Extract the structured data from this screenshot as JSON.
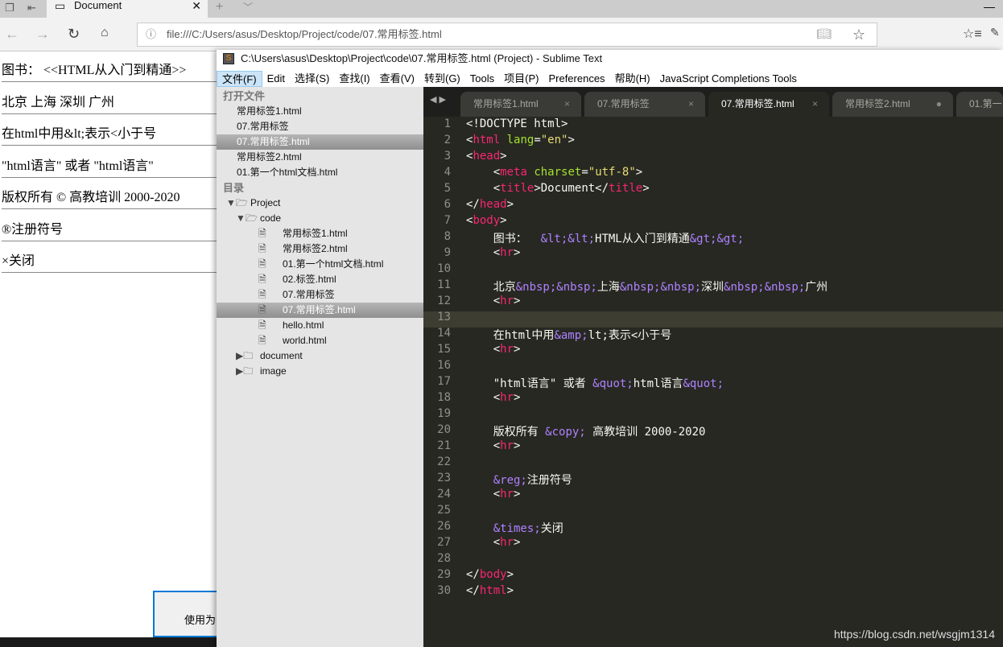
{
  "browser": {
    "tab_title": "Document",
    "url": "file:///C:/Users/asus/Desktop/Project/code/07.常用标签.html",
    "page_lines": [
      "图书： <<HTML从入门到精通>>",
      "北京  上海  深圳  广州",
      "在html中用&lt;表示<小于号",
      "\"html语言\" 或者 \"html语言\"",
      "版权所有 © 高教培训 2000-2020",
      "®注册符号",
      "×关闭"
    ],
    "dialog_text": "使用为"
  },
  "sublime": {
    "title": "C:\\Users\\asus\\Desktop\\Project\\code\\07.常用标签.html (Project) - Sublime Text",
    "menu": [
      "文件(F)",
      "Edit",
      "选择(S)",
      "查找(I)",
      "查看(V)",
      "转到(G)",
      "Tools",
      "项目(P)",
      "Preferences",
      "帮助(H)",
      "JavaScript Completions Tools"
    ],
    "sidebar": {
      "open_files_header": "打开文件",
      "open_files": [
        "常用标签1.html",
        "07.常用标签",
        "07.常用标签.html",
        "常用标签2.html",
        "01.第一个html文档.html"
      ],
      "selected_open": 2,
      "folders_header": "目录",
      "project": "Project",
      "code_folder": "code",
      "files": [
        "常用标签1.html",
        "常用标签2.html",
        "01.第一个html文档.html",
        "02.标签.html",
        "07.常用标签",
        "07.常用标签.html",
        "hello.html",
        "world.html"
      ],
      "selected_file": 5,
      "closed_folders": [
        "document",
        "image"
      ]
    },
    "tabs": [
      {
        "label": "常用标签1.html",
        "mark": "×"
      },
      {
        "label": "07.常用标签",
        "mark": "×"
      },
      {
        "label": "07.常用标签.html",
        "mark": "×",
        "active": true
      },
      {
        "label": "常用标签2.html",
        "mark": "●"
      },
      {
        "label": "01.第一"
      }
    ],
    "current_line": 13,
    "code": [
      [
        [
          "txt",
          "<!DOCTYPE html>"
        ]
      ],
      [
        [
          "txt",
          "<"
        ],
        [
          "tag",
          "html"
        ],
        [
          "txt",
          " "
        ],
        [
          "attr",
          "lang"
        ],
        [
          "txt",
          "="
        ],
        [
          "str",
          "\"en\""
        ],
        [
          "txt",
          ">"
        ]
      ],
      [
        [
          "txt",
          "<"
        ],
        [
          "tag",
          "head"
        ],
        [
          "txt",
          ">"
        ]
      ],
      [
        [
          "txt",
          "    <"
        ],
        [
          "tag",
          "meta"
        ],
        [
          "txt",
          " "
        ],
        [
          "attr",
          "charset"
        ],
        [
          "txt",
          "="
        ],
        [
          "str",
          "\"utf-8\""
        ],
        [
          "txt",
          ">"
        ]
      ],
      [
        [
          "txt",
          "    <"
        ],
        [
          "tag",
          "title"
        ],
        [
          "txt",
          ">Document</"
        ],
        [
          "tag",
          "title"
        ],
        [
          "txt",
          ">"
        ]
      ],
      [
        [
          "txt",
          "</"
        ],
        [
          "tag",
          "head"
        ],
        [
          "txt",
          ">"
        ]
      ],
      [
        [
          "txt",
          "<"
        ],
        [
          "tag",
          "body"
        ],
        [
          "txt",
          ">"
        ]
      ],
      [
        [
          "txt",
          "    图书：  "
        ],
        [
          "ent",
          "&lt;&lt;"
        ],
        [
          "txt",
          "HTML从入门到精通"
        ],
        [
          "ent",
          "&gt;&gt;"
        ]
      ],
      [
        [
          "txt",
          "    <"
        ],
        [
          "tag",
          "hr"
        ],
        [
          "txt",
          ">"
        ]
      ],
      [],
      [
        [
          "txt",
          "    北京"
        ],
        [
          "ent",
          "&nbsp;&nbsp;"
        ],
        [
          "txt",
          "上海"
        ],
        [
          "ent",
          "&nbsp;&nbsp;"
        ],
        [
          "txt",
          "深圳"
        ],
        [
          "ent",
          "&nbsp;&nbsp;"
        ],
        [
          "txt",
          "广州"
        ]
      ],
      [
        [
          "txt",
          "    <"
        ],
        [
          "tag",
          "hr"
        ],
        [
          "txt",
          ">"
        ]
      ],
      [],
      [
        [
          "txt",
          "    在html中用"
        ],
        [
          "ent",
          "&amp;"
        ],
        [
          "txt",
          "lt;表示<小于号"
        ]
      ],
      [
        [
          "txt",
          "    <"
        ],
        [
          "tag",
          "hr"
        ],
        [
          "txt",
          ">"
        ]
      ],
      [],
      [
        [
          "txt",
          "    \"html语言\" 或者 "
        ],
        [
          "ent",
          "&quot;"
        ],
        [
          "txt",
          "html语言"
        ],
        [
          "ent",
          "&quot;"
        ]
      ],
      [
        [
          "txt",
          "    <"
        ],
        [
          "tag",
          "hr"
        ],
        [
          "txt",
          ">"
        ]
      ],
      [],
      [
        [
          "txt",
          "    版权所有 "
        ],
        [
          "ent",
          "&copy;"
        ],
        [
          "txt",
          " 高教培训 2000-2020"
        ]
      ],
      [
        [
          "txt",
          "    <"
        ],
        [
          "tag",
          "hr"
        ],
        [
          "txt",
          ">"
        ]
      ],
      [],
      [
        [
          "txt",
          "    "
        ],
        [
          "ent",
          "&reg;"
        ],
        [
          "txt",
          "注册符号"
        ]
      ],
      [
        [
          "txt",
          "    <"
        ],
        [
          "tag",
          "hr"
        ],
        [
          "txt",
          ">"
        ]
      ],
      [],
      [
        [
          "txt",
          "    "
        ],
        [
          "ent",
          "&times;"
        ],
        [
          "txt",
          "关闭"
        ]
      ],
      [
        [
          "txt",
          "    <"
        ],
        [
          "tag",
          "hr"
        ],
        [
          "txt",
          ">"
        ]
      ],
      [],
      [
        [
          "txt",
          "</"
        ],
        [
          "tag",
          "body"
        ],
        [
          "txt",
          ">"
        ]
      ],
      [
        [
          "txt",
          "</"
        ],
        [
          "tag",
          "html"
        ],
        [
          "txt",
          ">"
        ]
      ]
    ]
  },
  "watermark": "https://blog.csdn.net/wsgjm1314",
  "colors": {
    "editor_bg": "#272822",
    "tag": "#f92672",
    "attr": "#a6e22e",
    "string": "#e6db74",
    "entity": "#ae81ff"
  }
}
